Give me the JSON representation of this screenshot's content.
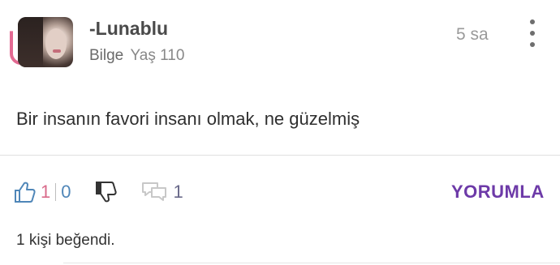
{
  "post": {
    "username": "-Lunablu",
    "badge": "Bilge",
    "age": "Yaş 110",
    "time": "5 sa",
    "message": "Bir insanın favori insanı olmak, ne güzelmiş"
  },
  "actions": {
    "like_count": "1",
    "dislike_count": "0",
    "comment_count": "1",
    "reply_label": "YORUMLA"
  },
  "footer": {
    "likes_text": "1 kişi beğendi."
  },
  "icons": {
    "like": "thumbs-up-icon",
    "dislike": "thumbs-down-icon",
    "comment": "comment-bubbles-icon",
    "more": "more-vertical-icon"
  },
  "colors": {
    "avatar_ring": "#e36a92",
    "like": "#d96a8a",
    "dislike": "#4f86b8",
    "reply": "#6d3aa8"
  }
}
